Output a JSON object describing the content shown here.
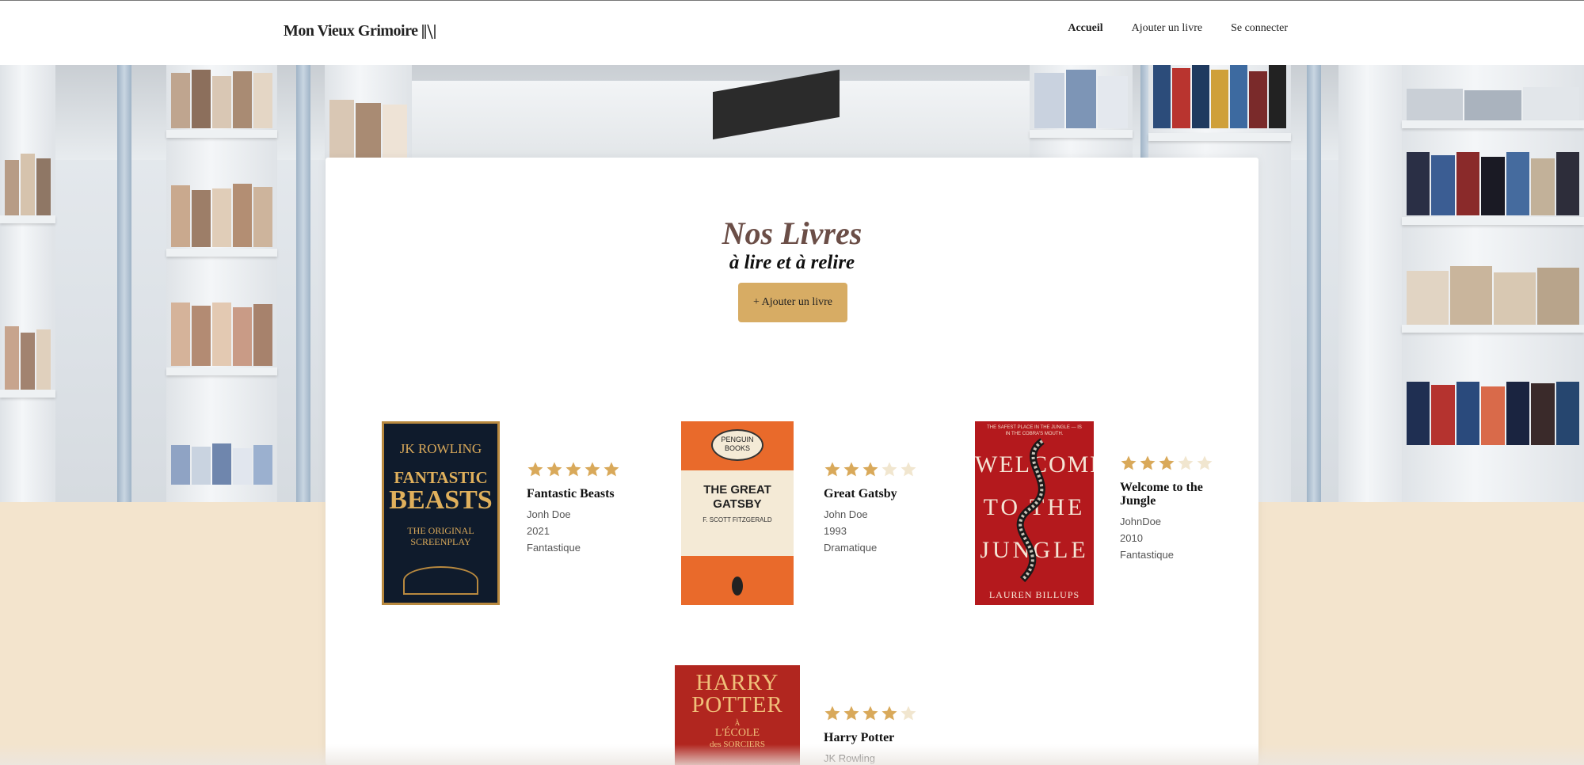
{
  "header": {
    "logo_text": "Mon Vieux Grimoire",
    "nav": [
      {
        "label": "Accueil",
        "active": true
      },
      {
        "label": "Ajouter un livre",
        "active": false
      },
      {
        "label": "Se connecter",
        "active": false
      }
    ]
  },
  "hero": {
    "title": "Nos Livres",
    "subtitle": "à lire et à relire",
    "add_button_label": "+ Ajouter un livre"
  },
  "books": [
    {
      "title": "Fantastic Beasts",
      "author": "Jonh Doe",
      "year": "2021",
      "genre": "Fantastique",
      "rating": 5,
      "cover": {
        "top": "JK ROWLING",
        "title1": "FANTASTIC",
        "title2": "BEASTS",
        "sub": "THE ORIGINAL SCREENPLAY"
      }
    },
    {
      "title": "Great Gatsby",
      "author": "John Doe",
      "year": "1993",
      "genre": "Dramatique",
      "rating": 3,
      "cover": {
        "publisher": "PENGUIN BOOKS",
        "title1": "THE GREAT",
        "title2": "GATSBY",
        "author": "F. SCOTT FITZGERALD"
      }
    },
    {
      "title": "Welcome to the Jungle",
      "author": "JohnDoe",
      "year": "2010",
      "genre": "Fantastique",
      "rating": 3,
      "cover": {
        "tagline": "THE SAFEST PLACE IN THE JUNGLE — IS IN THE COBRA'S MOUTH.",
        "title1": "WELCOME",
        "title2": "TO THE",
        "title3": "JUNGLE",
        "author": "LAUREN BILLUPS"
      }
    },
    {
      "title": "Harry Potter",
      "author": "JK Rowling",
      "rating": 4,
      "cover": {
        "title1": "HARRY",
        "title2": "POTTER",
        "sub1": "À",
        "sub2": "L'ÉCOLE",
        "sub3": "des SORCIERS"
      }
    }
  ],
  "colors": {
    "accent": "#d7ac64",
    "star_filled": "#d9a95a",
    "star_empty": "#f1e6cf",
    "title": "#6b4e47",
    "page_bg": "#f3e4cd"
  }
}
